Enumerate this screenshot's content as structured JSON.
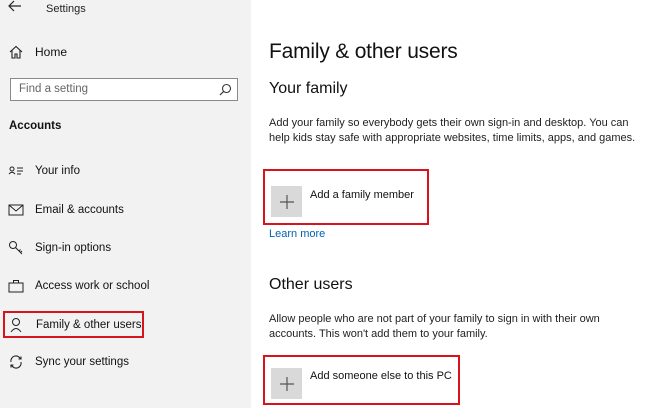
{
  "window": {
    "title": "Settings"
  },
  "sidebar": {
    "home_label": "Home",
    "search_placeholder": "Find a setting",
    "section_label": "Accounts",
    "items": [
      {
        "label": "Your info",
        "icon": "contact-card-icon"
      },
      {
        "label": "Email & accounts",
        "icon": "mail-icon"
      },
      {
        "label": "Sign-in options",
        "icon": "key-icon"
      },
      {
        "label": "Access work or school",
        "icon": "briefcase-icon"
      },
      {
        "label": "Family & other users",
        "icon": "person-icon",
        "active": true
      },
      {
        "label": "Sync your settings",
        "icon": "sync-icon"
      }
    ]
  },
  "main": {
    "title": "Family & other users",
    "family": {
      "heading": "Your family",
      "description": "Add your family so everybody gets their own sign-in and desktop. You can help kids stay safe with appropriate websites, time limits, apps, and games.",
      "add_label": "Add a family member",
      "link_label": "Learn more"
    },
    "other": {
      "heading": "Other users",
      "description": "Allow people who are not part of your family to sign in with their own accounts. This won't add them to your family.",
      "add_label": "Add someone else to this PC"
    }
  },
  "colors": {
    "highlight": "#d7141e",
    "link": "#0063b1",
    "sidebar_bg": "#f2f2f2"
  }
}
